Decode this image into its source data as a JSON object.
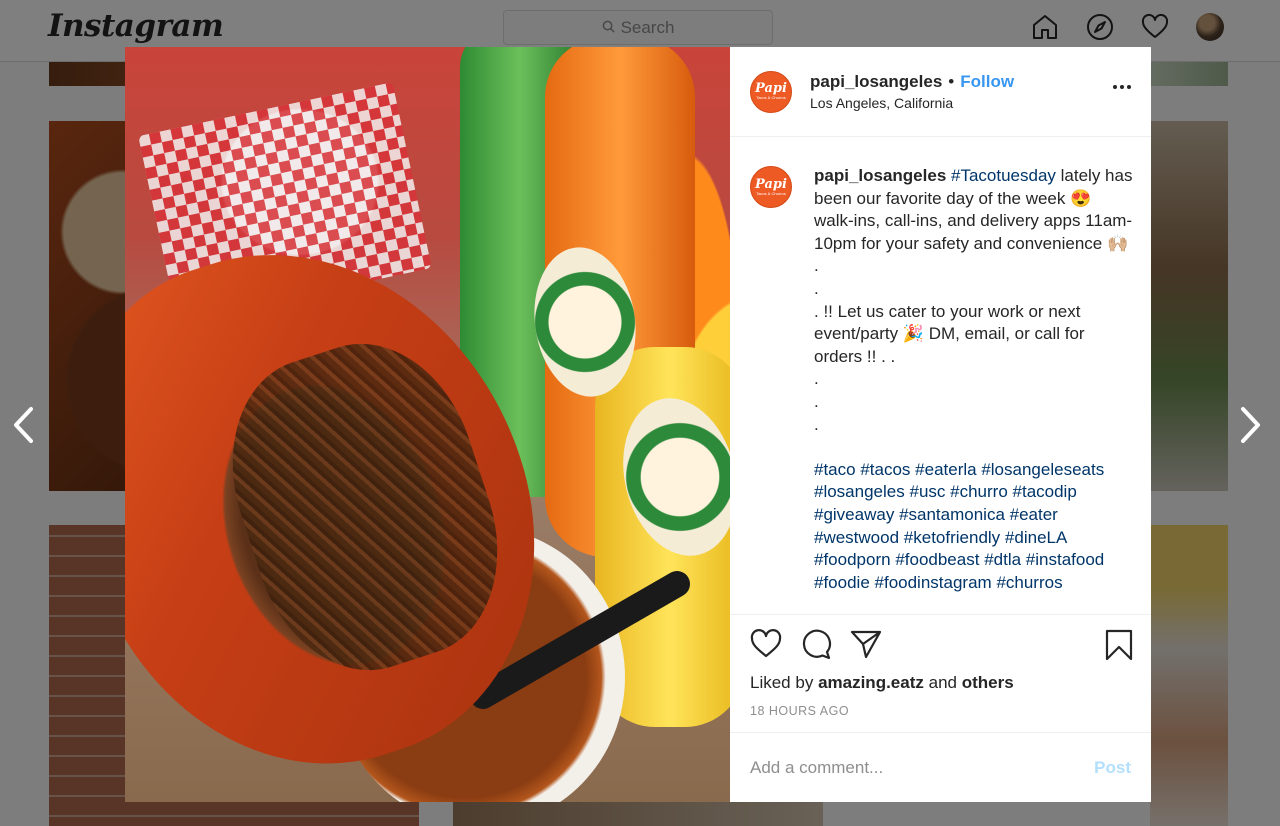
{
  "topbar": {
    "logo": "Instagram",
    "search_placeholder": "Search"
  },
  "post": {
    "username": "papi_losangeles",
    "follow_label": "Follow",
    "separator": "•",
    "location": "Los Angeles, California",
    "avatar_text": "Papi",
    "avatar_subtext": "Tacos & Churros",
    "caption": {
      "username": "papi_losangeles",
      "hashtag_first": "#Tacotuesday",
      "line1": " lately has been our favorite day of the week 😍",
      "line2": "walk-ins, call-ins, and delivery apps 11am-10pm for your safety and convenience 🙌🏼",
      "dot1": ".",
      "dot2": ".",
      "line3": ". !! Let us cater to your work or next event/party 🎉  DM, email, or call for orders !! . .",
      "dot3": ".",
      "dot4": ".",
      "dot5": ".",
      "hashtags": [
        "#taco",
        "#tacos",
        "#eaterla",
        "#losangeleseats",
        "#losangeles",
        "#usc",
        "#churro",
        "#tacodip",
        "#giveaway",
        "#santamonica",
        "#eater",
        "#westwood",
        "#ketofriendly",
        "#dineLA",
        "#foodporn",
        "#foodbeast",
        "#dtla",
        "#instafood",
        "#foodie",
        "#foodinstagram",
        "#churros"
      ]
    },
    "likes": {
      "prefix": "Liked by",
      "user": "amazing.eatz",
      "and": "and",
      "others": "others"
    },
    "time": "18 HOURS AGO",
    "comment_placeholder": "Add a comment...",
    "post_label": "Post"
  },
  "colors": {
    "accent": "#3897f0",
    "hashtag": "#003569",
    "papi_orange": "#ee5a24"
  },
  "icons": [
    "search-icon",
    "home-icon",
    "explore-icon",
    "heart-icon",
    "profile-avatar",
    "more-icon",
    "like-icon",
    "comment-icon",
    "share-icon",
    "save-icon",
    "prev-arrow-icon",
    "next-arrow-icon"
  ]
}
